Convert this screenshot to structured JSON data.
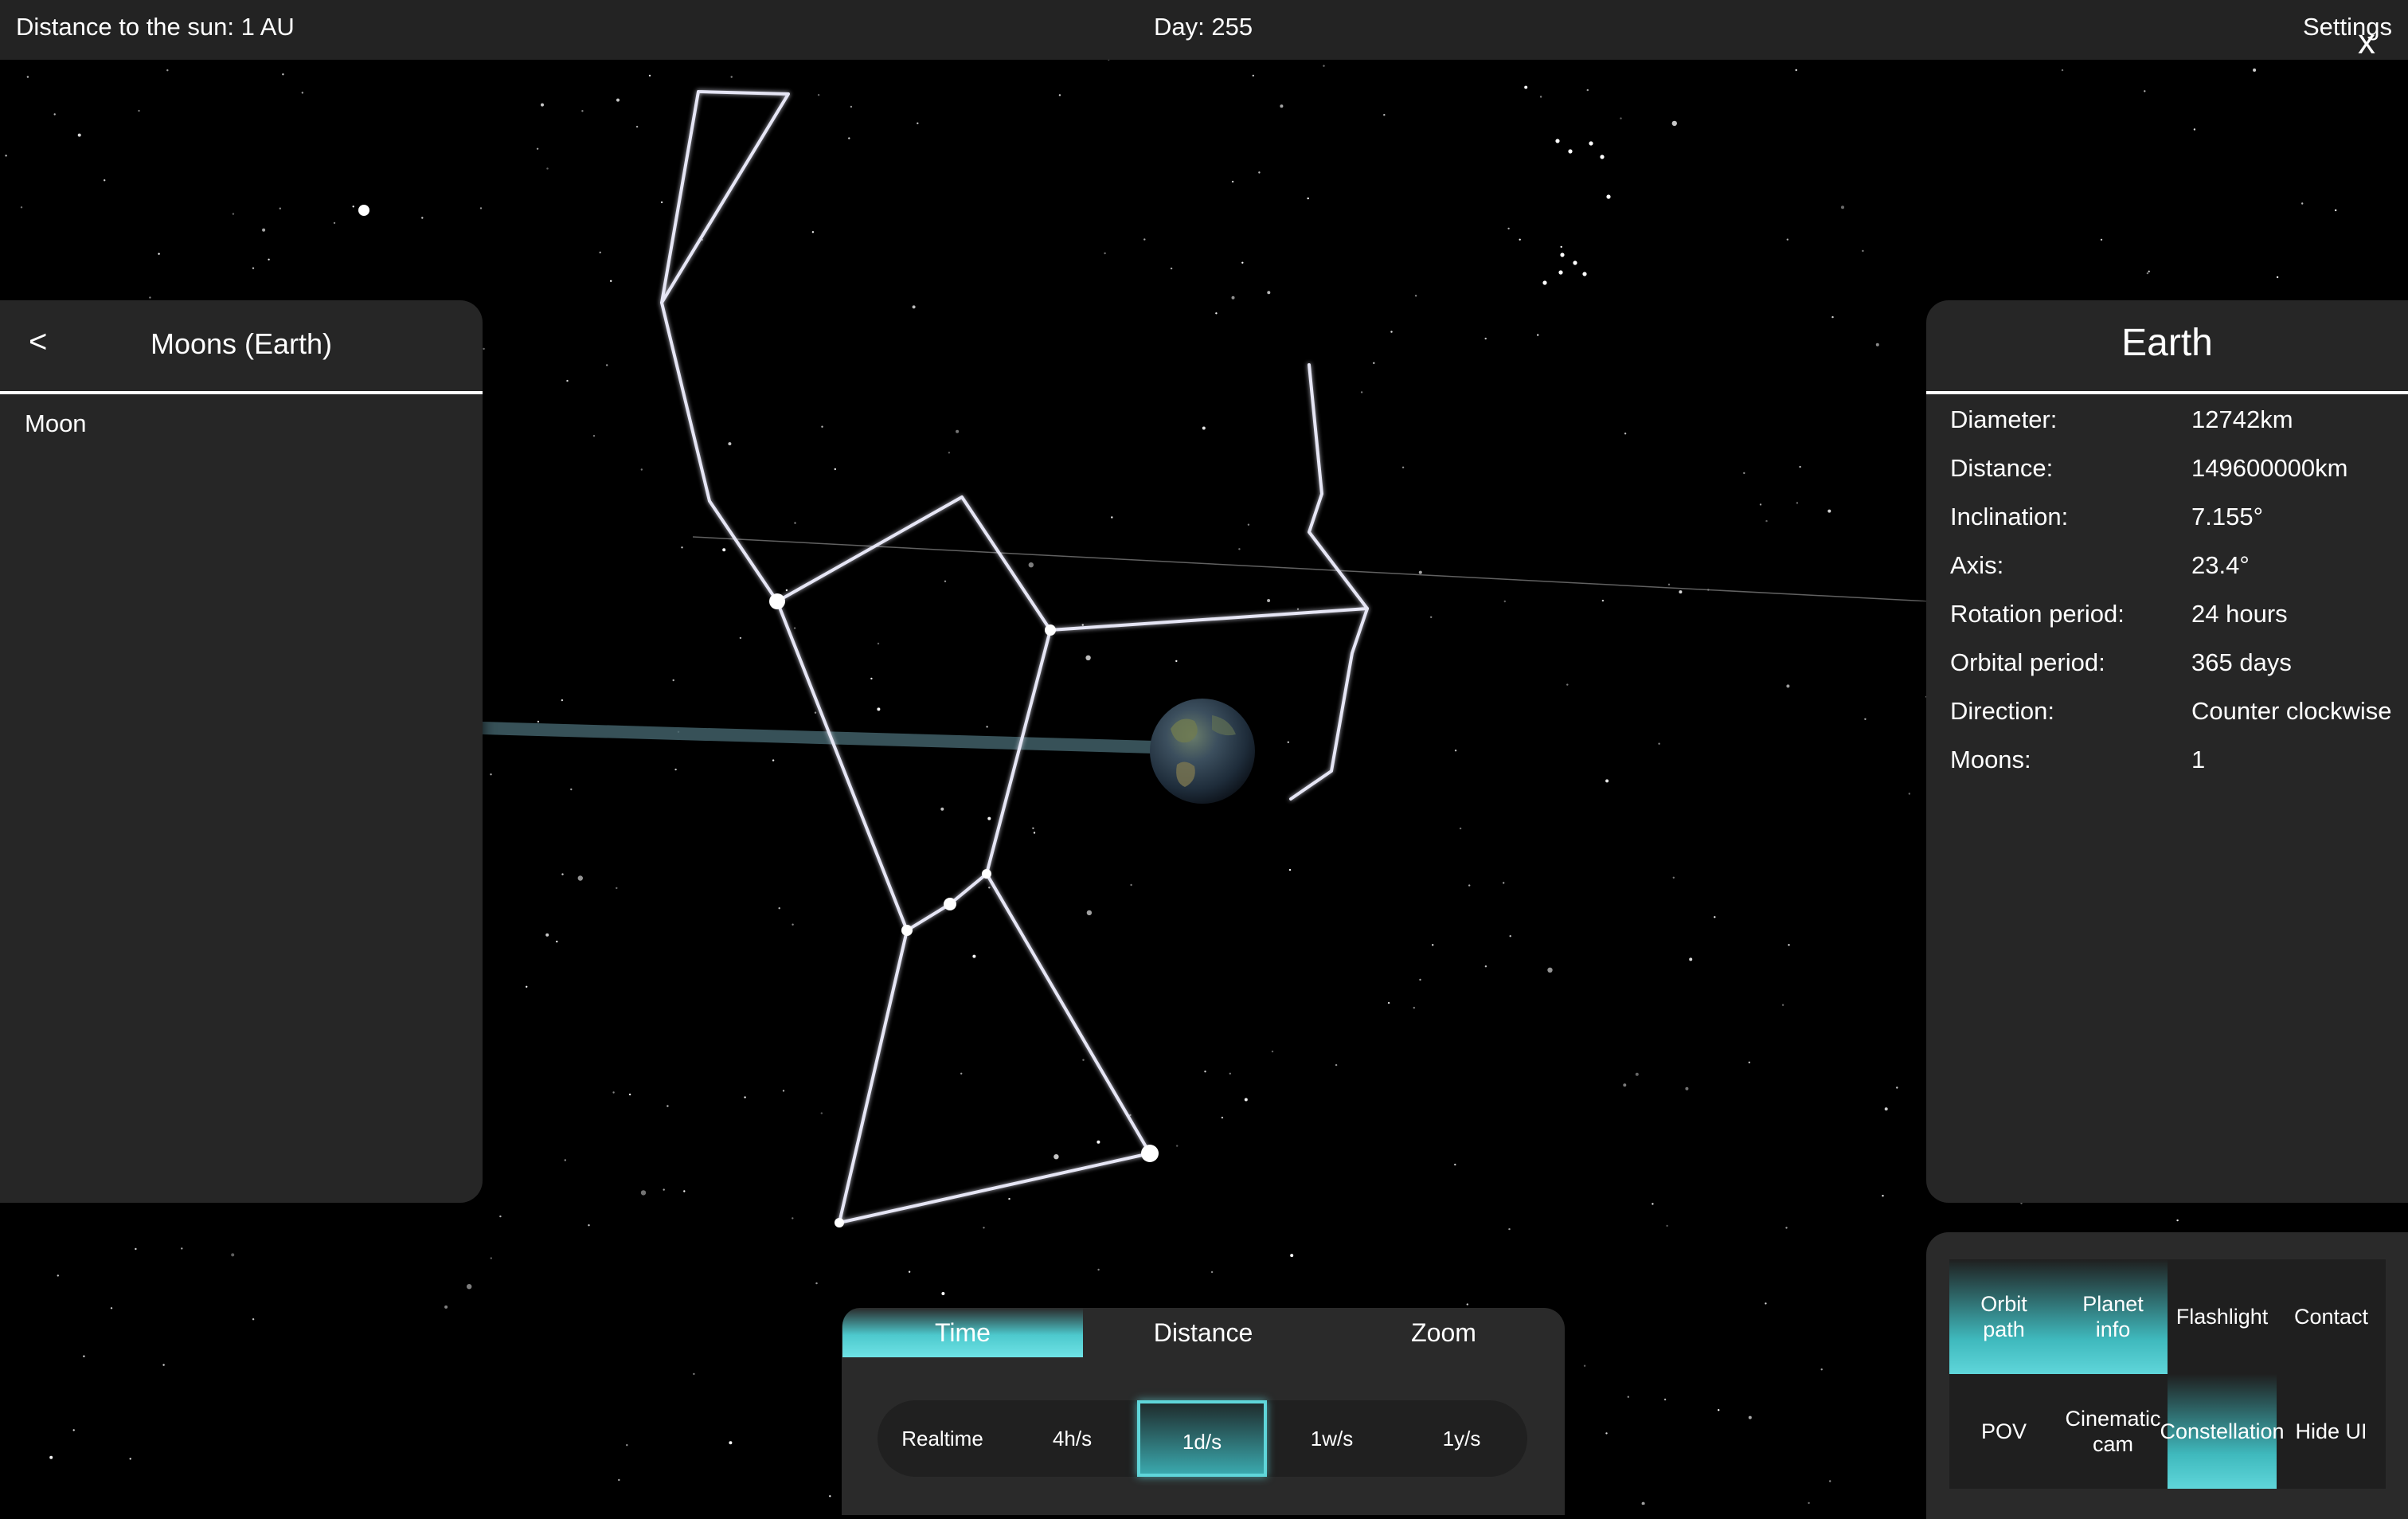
{
  "topbar": {
    "distance": "Distance to the sun: 1 AU",
    "day": "Day: 255",
    "settings": "Settings"
  },
  "left_panel": {
    "back": "<",
    "title": "Moons (Earth)",
    "items": [
      "Moon"
    ]
  },
  "right_panel": {
    "title": "Earth",
    "close": "x",
    "rows": [
      {
        "label": "Diameter:",
        "value": "12742km"
      },
      {
        "label": "Distance:",
        "value": "149600000km"
      },
      {
        "label": "Inclination:",
        "value": "7.155°"
      },
      {
        "label": "Axis:",
        "value": "23.4°"
      },
      {
        "label": "Rotation period:",
        "value": "24 hours"
      },
      {
        "label": "Orbital period:",
        "value": "365 days"
      },
      {
        "label": "Direction:",
        "value": "Counter clockwise"
      },
      {
        "label": "Moons:",
        "value": "1"
      }
    ]
  },
  "time_panel": {
    "tabs": [
      "Time",
      "Distance",
      "Zoom"
    ],
    "active_tab": "Time",
    "speeds": [
      "Realtime",
      "4h/s",
      "1d/s",
      "1w/s",
      "1y/s"
    ],
    "active_speed": "1d/s"
  },
  "controls": {
    "buttons": [
      {
        "label": "Orbit\npath",
        "active": true
      },
      {
        "label": "Planet\ninfo",
        "active": true
      },
      {
        "label": "Flashlight",
        "active": false
      },
      {
        "label": "Contact",
        "active": false
      },
      {
        "label": "POV",
        "active": false
      },
      {
        "label": "Cinematic\ncam",
        "active": false
      },
      {
        "label": "Constellation",
        "active": true
      },
      {
        "label": "Hide UI",
        "active": false
      }
    ]
  },
  "colors": {
    "accent": "#5fd6da",
    "panel": "#262626",
    "background": "#000000"
  }
}
